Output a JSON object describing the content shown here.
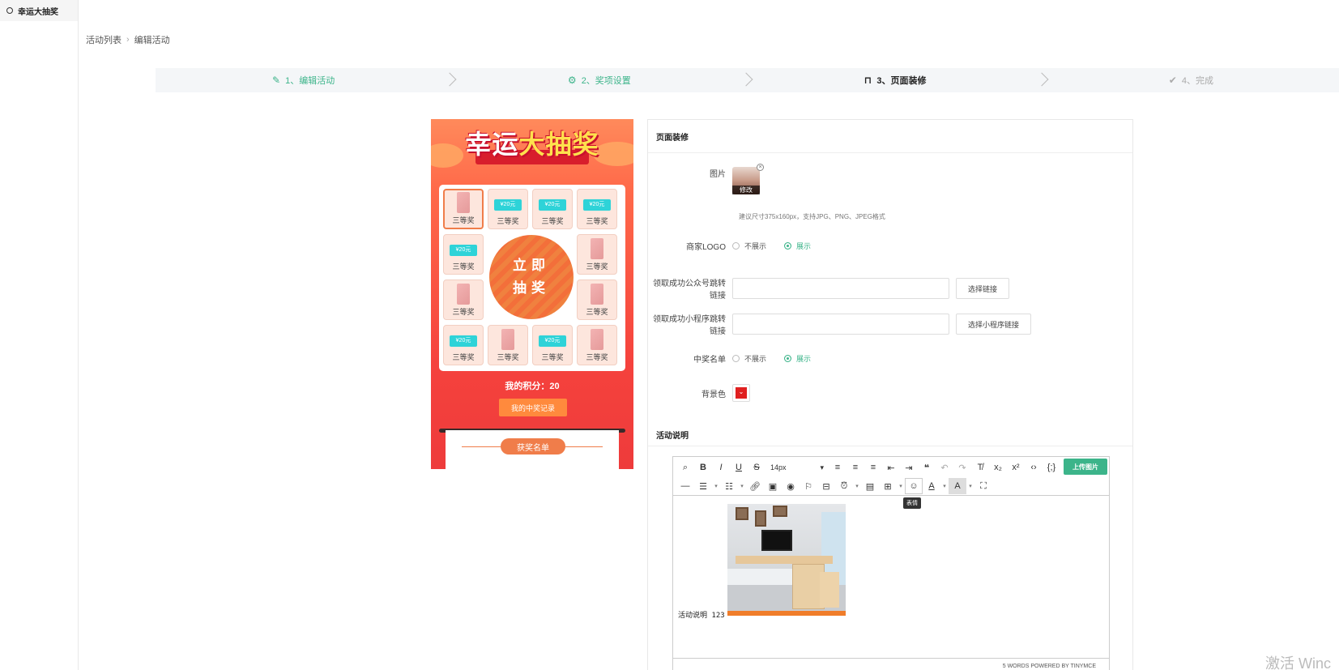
{
  "sidebar": {
    "items": [
      {
        "label": "幸运大抽奖"
      }
    ]
  },
  "breadcrumb": {
    "parent": "活动列表",
    "current": "编辑活动"
  },
  "steps": [
    {
      "label": "1、编辑活动",
      "state": "done",
      "icon": "edit-icon"
    },
    {
      "label": "2、奖项设置",
      "state": "done",
      "icon": "settings-icon"
    },
    {
      "label": "3、页面装修",
      "state": "active",
      "icon": "bag-icon"
    },
    {
      "label": "4、完成",
      "state": "todo",
      "icon": "check-circle-icon"
    }
  ],
  "preview": {
    "title_part1": "幸运",
    "title_part2": "大抽奖",
    "draw_button_line1": "立即",
    "draw_button_line2": "抽奖",
    "prize_label": "三等奖",
    "coupon_text": "¥20元",
    "score_text": "我的积分：20",
    "record_button": "我的中奖记录",
    "winners_title": "获奖名单"
  },
  "panel": {
    "title": "页面装修",
    "image_label": "图片",
    "image_edit": "修改",
    "image_hint": "建议尺寸375x160px，支持JPG、PNG、JPEG格式",
    "logo_label": "商家LOGO",
    "option_hide": "不展示",
    "option_show": "展示",
    "official_link_label": "领取成功公众号跳转链接",
    "select_link_button": "选择链接",
    "mini_link_label": "领取成功小程序跳转链接",
    "select_mini_button": "选择小程序链接",
    "winners_list_label": "中奖名单",
    "bg_color_label": "背景色",
    "bg_color": "#e02020",
    "accent_color": "#3cb48a",
    "desc_section_title": "活动说明"
  },
  "editor": {
    "font_size": "14px",
    "upload_button": "上传图片",
    "emoji_tooltip": "表情",
    "content_text": "活动说明 123",
    "status": "5 WORDS POWERED BY TINYMCE"
  },
  "watermark": "激活 Winc"
}
